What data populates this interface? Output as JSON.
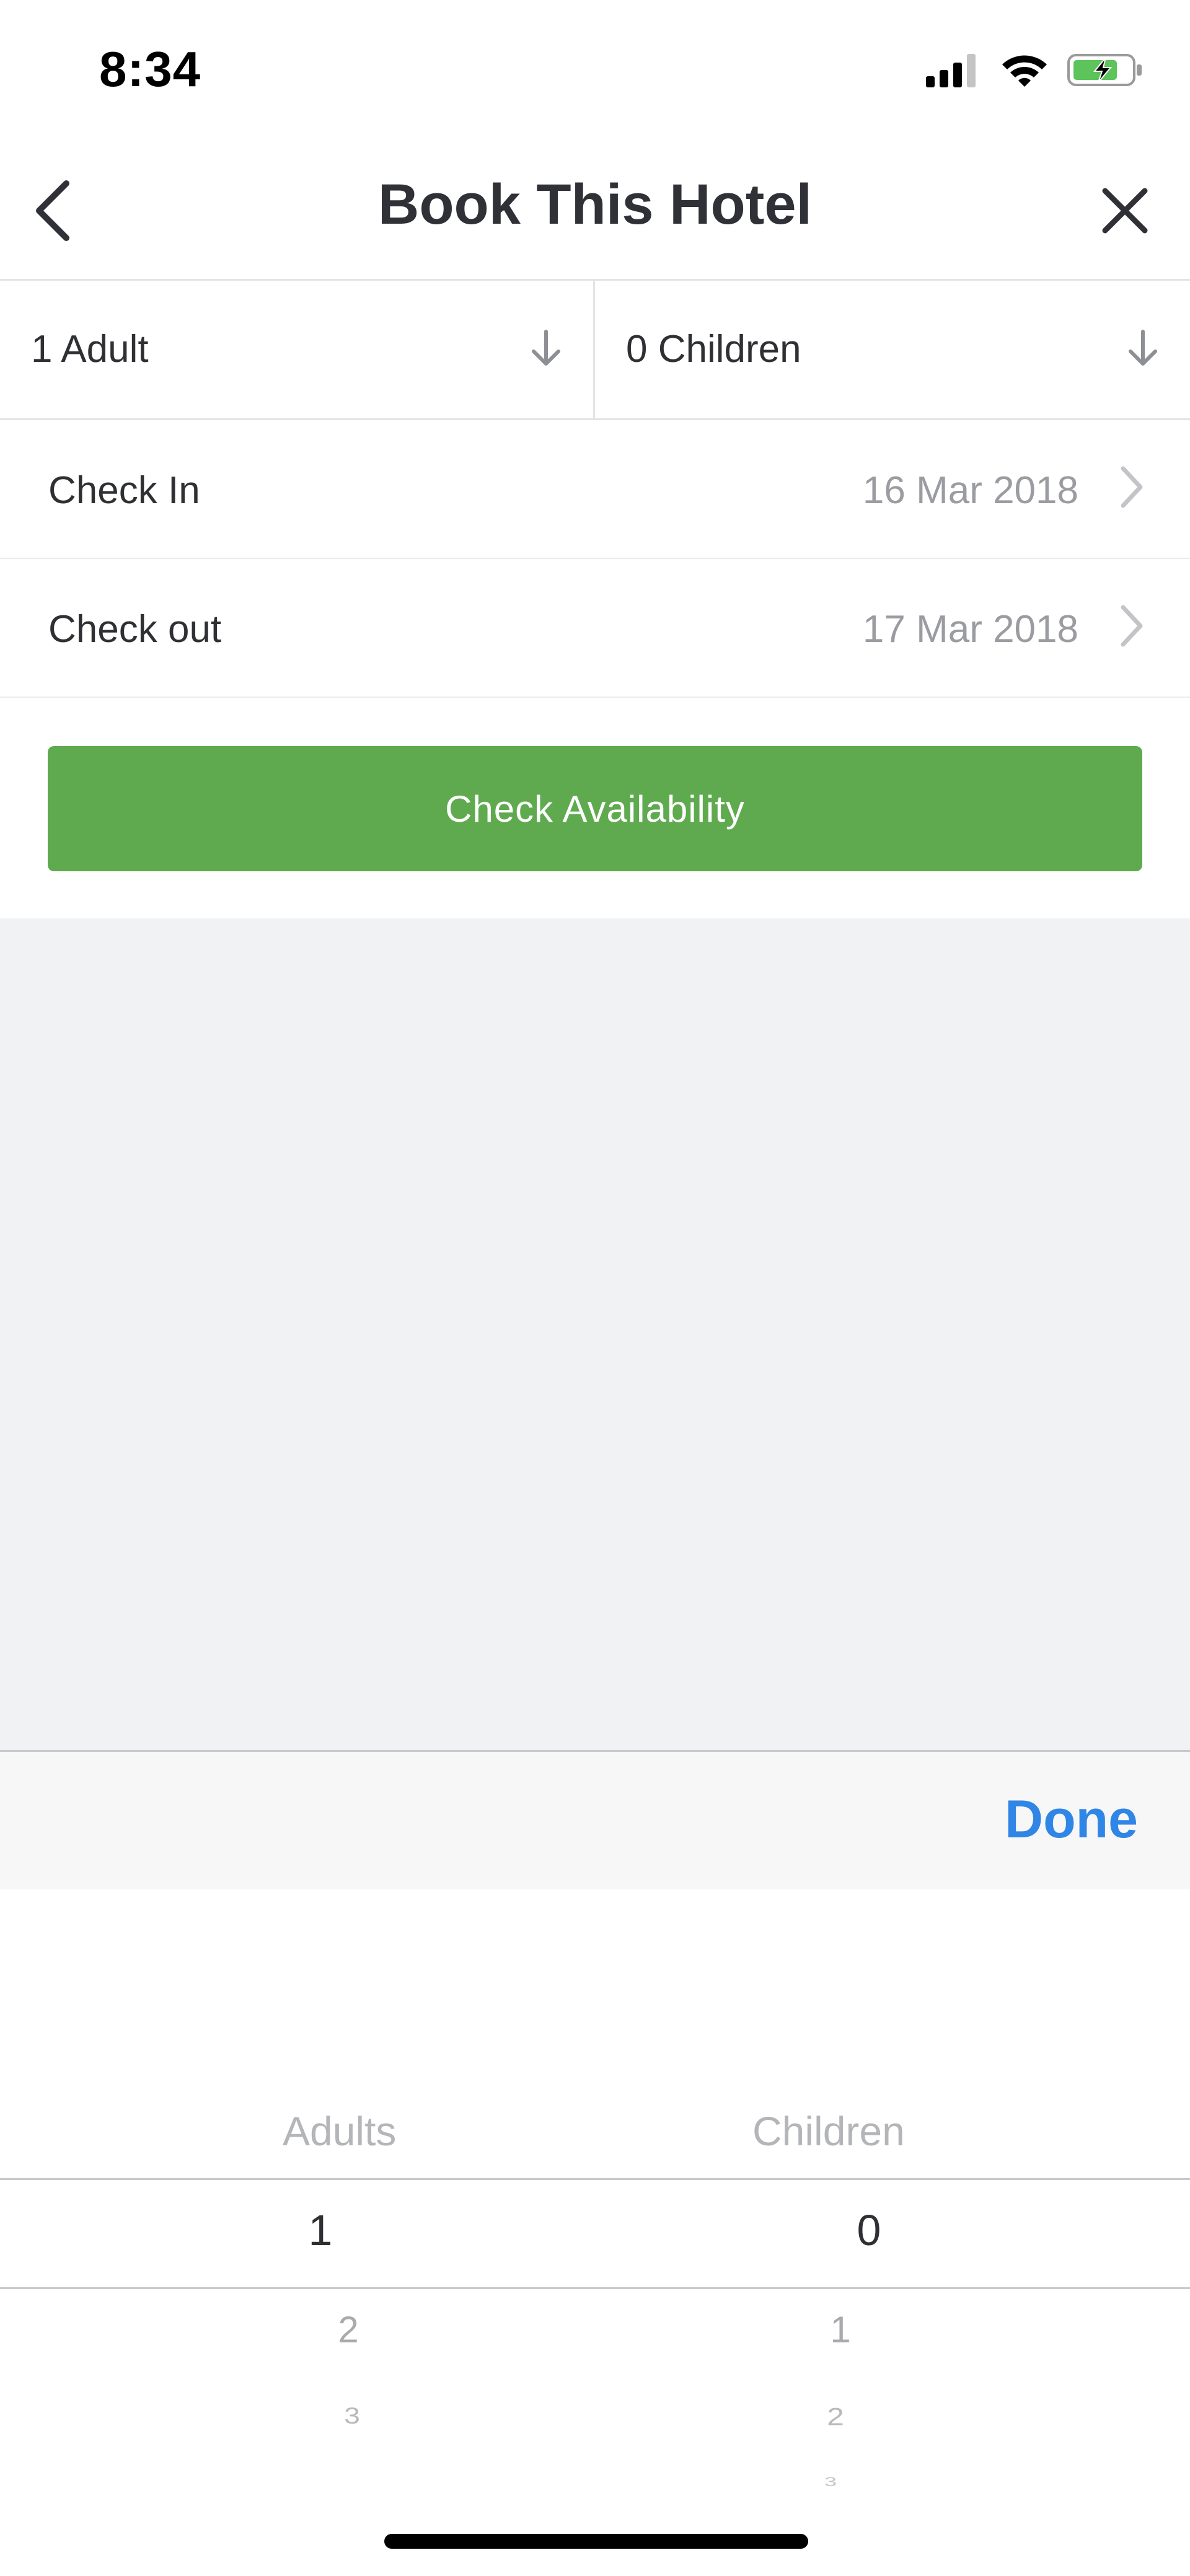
{
  "status_bar": {
    "time": "8:34",
    "icons": [
      "signal-icon",
      "wifi-icon",
      "battery-charging-icon"
    ]
  },
  "nav": {
    "title": "Book This Hotel",
    "back_icon": "chevron-left-icon",
    "close_icon": "close-icon"
  },
  "guests": {
    "adults_label": "1 Adult",
    "children_label": "0 Children",
    "arrow_icon": "arrow-down-icon"
  },
  "dates": [
    {
      "label": "Check In",
      "value": "16 Mar 2018"
    },
    {
      "label": "Check out",
      "value": "17 Mar 2018"
    }
  ],
  "actions": {
    "check_availability": "Check Availability"
  },
  "picker_toolbar": {
    "done_label": "Done"
  },
  "picker": {
    "adults": {
      "header": "Adults",
      "selected": "1",
      "options": [
        "2",
        "3"
      ]
    },
    "children": {
      "header": "Children",
      "selected": "0",
      "options": [
        "1",
        "2",
        "3"
      ]
    }
  },
  "colors": {
    "accent_green": "#5faa4f",
    "link_blue": "#2f86e6",
    "background_grey": "#f1f2f4"
  }
}
